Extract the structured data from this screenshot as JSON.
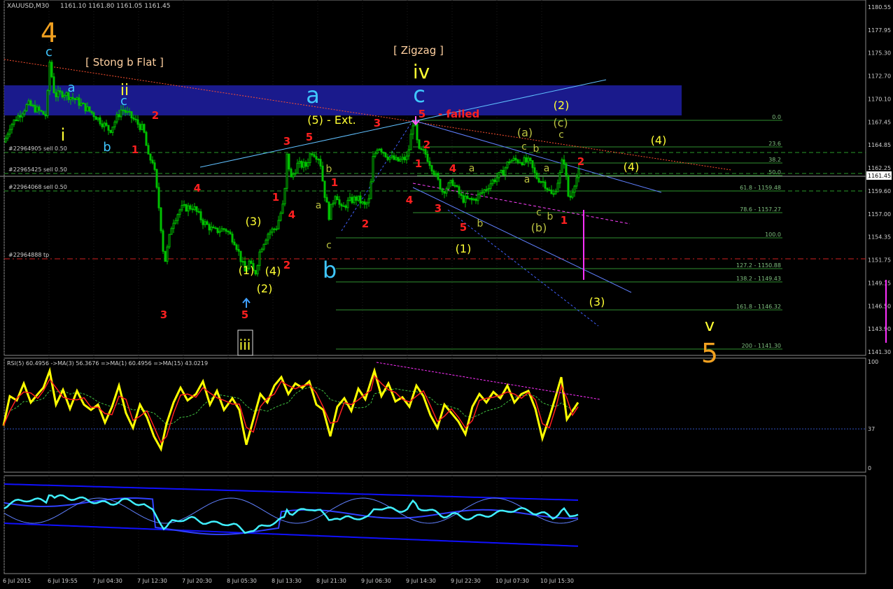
{
  "header": {
    "symbol": "XAUUSD,M30",
    "ohlc": "1161.10 1161.80 1161.05 1161.45"
  },
  "colors": {
    "background": "#000000",
    "grid": "#1c1c1c",
    "candle": "#00c000",
    "fib": "#2f8f2f",
    "wave_red": "#ff2020",
    "wave_yellow": "#ffff33",
    "wave_orange": "#f0a020",
    "wave_cyan": "#3fc7ff",
    "wave_olive": "#b8c040",
    "rsi_line": "#ffff00",
    "rsi_ma_fast": "#ff2020",
    "rsi_ma_slow": "#40c040",
    "band": "#1a1a8c",
    "magenta": "#ff30ff"
  },
  "price_axis": {
    "ticks": [
      "1180.55",
      "1177.95",
      "1175.30",
      "1172.70",
      "1170.10",
      "1167.45",
      "1164.85",
      "1162.25",
      "1159.60",
      "1157.00",
      "1154.35",
      "1151.75",
      "1149.15",
      "1146.50",
      "1143.90",
      "1141.30"
    ],
    "current": "1161.45"
  },
  "time_axis": {
    "labels": [
      "6 Jul 2015",
      "6 Jul 19:55",
      "7 Jul 04:30",
      "7 Jul 12:30",
      "7 Jul 20:30",
      "8 Jul 05:30",
      "8 Jul 13:30",
      "8 Jul 21:30",
      "9 Jul 06:30",
      "9 Jul 14:30",
      "9 Jul 22:30",
      "10 Jul 07:30",
      "10 Jul 15:30"
    ]
  },
  "order_labels": [
    "#22964905 sell 0.50",
    "#22965425 sell 0.50",
    "#22964068 sell 0.50",
    "#22964888 tp"
  ],
  "fib_labels": [
    "0.0",
    "23.6",
    "38.2",
    "50.0",
    "61.8 - 1159.48",
    "78.6 - 1157.27",
    "100.0",
    "127.2 - 1150.88",
    "138.2 - 1149.43",
    "161.8 - 1146.32",
    "200 - 1141.30"
  ],
  "annotations": {
    "stong_b_flat": "[ Stong b Flat ]",
    "zigzag": "[ Zigzag ]",
    "ext": "(5) - Ext.",
    "failed": "- failed"
  },
  "wave_labels": [
    {
      "t": "4",
      "c": "orange",
      "s": 38
    },
    {
      "t": "c",
      "c": "cyan",
      "s": 18
    },
    {
      "t": "a",
      "c": "cyan",
      "s": 18
    },
    {
      "t": "ii",
      "c": "yellow",
      "s": 22
    },
    {
      "t": "c",
      "c": "cyan",
      "s": 18
    },
    {
      "t": "i",
      "c": "yellow",
      "s": 24
    },
    {
      "t": "b",
      "c": "cyan",
      "s": 18
    },
    {
      "t": "2",
      "c": "red",
      "s": 15
    },
    {
      "t": "1",
      "c": "red",
      "s": 15
    },
    {
      "t": "4",
      "c": "red",
      "s": 15
    },
    {
      "t": "3",
      "c": "red",
      "s": 15
    },
    {
      "t": "(3)",
      "c": "yellow",
      "s": 16
    },
    {
      "t": "(1)",
      "c": "yellow",
      "s": 16
    },
    {
      "t": "(4)",
      "c": "yellow",
      "s": 16
    },
    {
      "t": "(2)",
      "c": "yellow",
      "s": 16
    },
    {
      "t": "5",
      "c": "red",
      "s": 15
    },
    {
      "t": "iii",
      "c": "yellow",
      "s": 20
    },
    {
      "t": "3",
      "c": "red",
      "s": 15
    },
    {
      "t": "1",
      "c": "red",
      "s": 15
    },
    {
      "t": "4",
      "c": "red",
      "s": 15
    },
    {
      "t": "2",
      "c": "red",
      "s": 15
    },
    {
      "t": "5",
      "c": "red",
      "s": 15
    },
    {
      "t": "a",
      "c": "cyan",
      "s": 32
    },
    {
      "t": "c",
      "c": "olive",
      "s": 14
    },
    {
      "t": "a",
      "c": "olive",
      "s": 14
    },
    {
      "t": "b",
      "c": "olive",
      "s": 14
    },
    {
      "t": "1",
      "c": "red",
      "s": 15
    },
    {
      "t": "2",
      "c": "red",
      "s": 15
    },
    {
      "t": "3",
      "c": "red",
      "s": 15
    },
    {
      "t": "b",
      "c": "cyan",
      "s": 32
    },
    {
      "t": "iv",
      "c": "yellow",
      "s": 28
    },
    {
      "t": "c",
      "c": "cyan",
      "s": 32
    },
    {
      "t": "5",
      "c": "red",
      "s": 15
    },
    {
      "t": "2",
      "c": "red",
      "s": 15
    },
    {
      "t": "1",
      "c": "red",
      "s": 15
    },
    {
      "t": "4",
      "c": "red",
      "s": 15
    },
    {
      "t": "4",
      "c": "red",
      "s": 15
    },
    {
      "t": "3",
      "c": "red",
      "s": 15
    },
    {
      "t": "5",
      "c": "red",
      "s": 15
    },
    {
      "t": "a",
      "c": "olive",
      "s": 14
    },
    {
      "t": "b",
      "c": "olive",
      "s": 14
    },
    {
      "t": "(1)",
      "c": "yellow",
      "s": 16
    },
    {
      "t": "(a)",
      "c": "olive",
      "s": 16
    },
    {
      "t": "c",
      "c": "olive",
      "s": 14
    },
    {
      "t": "b",
      "c": "olive",
      "s": 14
    },
    {
      "t": "a",
      "c": "olive",
      "s": 14
    },
    {
      "t": "a",
      "c": "olive",
      "s": 14
    },
    {
      "t": "c",
      "c": "olive",
      "s": 14
    },
    {
      "t": "b",
      "c": "olive",
      "s": 14
    },
    {
      "t": "(b)",
      "c": "olive",
      "s": 16
    },
    {
      "t": "(2)",
      "c": "yellow",
      "s": 16
    },
    {
      "t": "(c)",
      "c": "olive",
      "s": 16
    },
    {
      "t": "c",
      "c": "olive",
      "s": 14
    },
    {
      "t": "2",
      "c": "red",
      "s": 15
    },
    {
      "t": "1",
      "c": "red",
      "s": 15
    },
    {
      "t": "(4)",
      "c": "yellow",
      "s": 16
    },
    {
      "t": "(4)",
      "c": "yellow",
      "s": 16
    },
    {
      "t": "(3)",
      "c": "yellow",
      "s": 16
    },
    {
      "t": "v",
      "c": "yellow",
      "s": 24
    },
    {
      "t": "5",
      "c": "orange",
      "s": 38
    }
  ],
  "rsi": {
    "label": "RSI(5) 60.4956  ->MA(3) 56.3676  =>MA(1) 60.4956  =>MA(15) 43.0219",
    "ticks": [
      "100",
      "37",
      "0"
    ]
  },
  "chart_data": {
    "type": "candlestick",
    "symbol": "XAUUSD",
    "timeframe": "M30",
    "ylim": [
      1141.3,
      1180.55
    ],
    "fib_levels": [
      {
        "ratio": "0.0"
      },
      {
        "ratio": "23.6"
      },
      {
        "ratio": "38.2"
      },
      {
        "ratio": "50.0"
      },
      {
        "ratio": "61.8",
        "price": 1159.48
      },
      {
        "ratio": "78.6",
        "price": 1157.27
      },
      {
        "ratio": "100.0"
      },
      {
        "ratio": "127.2",
        "price": 1150.88
      },
      {
        "ratio": "138.2",
        "price": 1149.43
      },
      {
        "ratio": "161.8",
        "price": 1146.32
      },
      {
        "ratio": "200",
        "price": 1141.3
      }
    ],
    "path": [
      [
        0,
        1163.6
      ],
      [
        14,
        1166.8
      ],
      [
        40,
        1169.3
      ],
      [
        66,
        1168.0
      ],
      [
        71,
        1174.1
      ],
      [
        78,
        1170.3
      ],
      [
        91,
        1170.6
      ],
      [
        108,
        1169.8
      ],
      [
        133,
        1168.2
      ],
      [
        157,
        1166.3
      ],
      [
        174,
        1168.8
      ],
      [
        188,
        1167.8
      ],
      [
        205,
        1166.4
      ],
      [
        212,
        1163.2
      ],
      [
        219,
        1162.8
      ],
      [
        228,
        1156.9
      ],
      [
        235,
        1151.1
      ],
      [
        246,
        1155.8
      ],
      [
        258,
        1157.4
      ],
      [
        276,
        1157.6
      ],
      [
        290,
        1155.9
      ],
      [
        306,
        1154.8
      ],
      [
        322,
        1155.1
      ],
      [
        336,
        1153.6
      ],
      [
        350,
        1150.2
      ],
      [
        356,
        1151.3
      ],
      [
        364,
        1149.8
      ],
      [
        372,
        1152.8
      ],
      [
        382,
        1154.5
      ],
      [
        395,
        1155.3
      ],
      [
        406,
        1158.2
      ],
      [
        410,
        1163.4
      ],
      [
        416,
        1160.8
      ],
      [
        425,
        1162.4
      ],
      [
        437,
        1162.3
      ],
      [
        445,
        1164.0
      ],
      [
        457,
        1163.1
      ],
      [
        463,
        1159.4
      ],
      [
        470,
        1156.6
      ],
      [
        480,
        1159.4
      ],
      [
        487,
        1157.2
      ],
      [
        498,
        1158.2
      ],
      [
        510,
        1158.6
      ],
      [
        521,
        1157.7
      ],
      [
        528,
        1158.4
      ],
      [
        533,
        1163.1
      ],
      [
        540,
        1164.6
      ],
      [
        553,
        1163.4
      ],
      [
        568,
        1162.8
      ],
      [
        582,
        1163.2
      ],
      [
        591,
        1167.7
      ],
      [
        598,
        1163.9
      ],
      [
        607,
        1163.8
      ],
      [
        619,
        1161.8
      ],
      [
        632,
        1159.4
      ],
      [
        647,
        1160.4
      ],
      [
        660,
        1158.5
      ],
      [
        675,
        1158.3
      ],
      [
        690,
        1159.3
      ],
      [
        703,
        1160.5
      ],
      [
        717,
        1161.4
      ],
      [
        728,
        1162.9
      ],
      [
        740,
        1162.9
      ],
      [
        757,
        1162.7
      ],
      [
        765,
        1161.1
      ],
      [
        778,
        1160.3
      ],
      [
        790,
        1158.7
      ],
      [
        800,
        1161.3
      ],
      [
        805,
        1163.5
      ],
      [
        813,
        1158.2
      ],
      [
        821,
        1160.4
      ],
      [
        827,
        1161.5
      ]
    ],
    "rsi": {
      "ylim": [
        0,
        100
      ],
      "level": 37,
      "path": [
        [
          5,
          40
        ],
        [
          14,
          68
        ],
        [
          24,
          64
        ],
        [
          34,
          80
        ],
        [
          44,
          62
        ],
        [
          54,
          70
        ],
        [
          62,
          76
        ],
        [
          71,
          92
        ],
        [
          80,
          60
        ],
        [
          90,
          74
        ],
        [
          100,
          56
        ],
        [
          110,
          73
        ],
        [
          120,
          60
        ],
        [
          130,
          55
        ],
        [
          140,
          60
        ],
        [
          150,
          43
        ],
        [
          160,
          58
        ],
        [
          170,
          78
        ],
        [
          180,
          52
        ],
        [
          190,
          38
        ],
        [
          200,
          60
        ],
        [
          210,
          48
        ],
        [
          220,
          30
        ],
        [
          230,
          18
        ],
        [
          238,
          42
        ],
        [
          248,
          62
        ],
        [
          258,
          76
        ],
        [
          268,
          64
        ],
        [
          280,
          70
        ],
        [
          290,
          82
        ],
        [
          300,
          60
        ],
        [
          310,
          73
        ],
        [
          320,
          55
        ],
        [
          332,
          66
        ],
        [
          342,
          55
        ],
        [
          352,
          22
        ],
        [
          362,
          46
        ],
        [
          372,
          70
        ],
        [
          382,
          62
        ],
        [
          392,
          78
        ],
        [
          402,
          86
        ],
        [
          412,
          70
        ],
        [
          422,
          80
        ],
        [
          432,
          76
        ],
        [
          442,
          82
        ],
        [
          452,
          60
        ],
        [
          462,
          55
        ],
        [
          472,
          30
        ],
        [
          482,
          58
        ],
        [
          492,
          66
        ],
        [
          502,
          54
        ],
        [
          512,
          75
        ],
        [
          522,
          65
        ],
        [
          530,
          82
        ],
        [
          535,
          92
        ],
        [
          545,
          68
        ],
        [
          555,
          80
        ],
        [
          565,
          63
        ],
        [
          575,
          67
        ],
        [
          585,
          58
        ],
        [
          595,
          78
        ],
        [
          605,
          68
        ],
        [
          615,
          50
        ],
        [
          625,
          38
        ],
        [
          635,
          60
        ],
        [
          645,
          52
        ],
        [
          655,
          44
        ],
        [
          665,
          32
        ],
        [
          675,
          58
        ],
        [
          685,
          70
        ],
        [
          695,
          62
        ],
        [
          705,
          72
        ],
        [
          715,
          66
        ],
        [
          725,
          78
        ],
        [
          735,
          62
        ],
        [
          745,
          70
        ],
        [
          755,
          73
        ],
        [
          765,
          56
        ],
        [
          775,
          28
        ],
        [
          785,
          48
        ],
        [
          795,
          70
        ],
        [
          802,
          86
        ],
        [
          810,
          46
        ],
        [
          818,
          54
        ],
        [
          826,
          62
        ]
      ],
      "trendline": [
        [
          538,
          100
        ],
        [
          857,
          65
        ]
      ]
    }
  }
}
